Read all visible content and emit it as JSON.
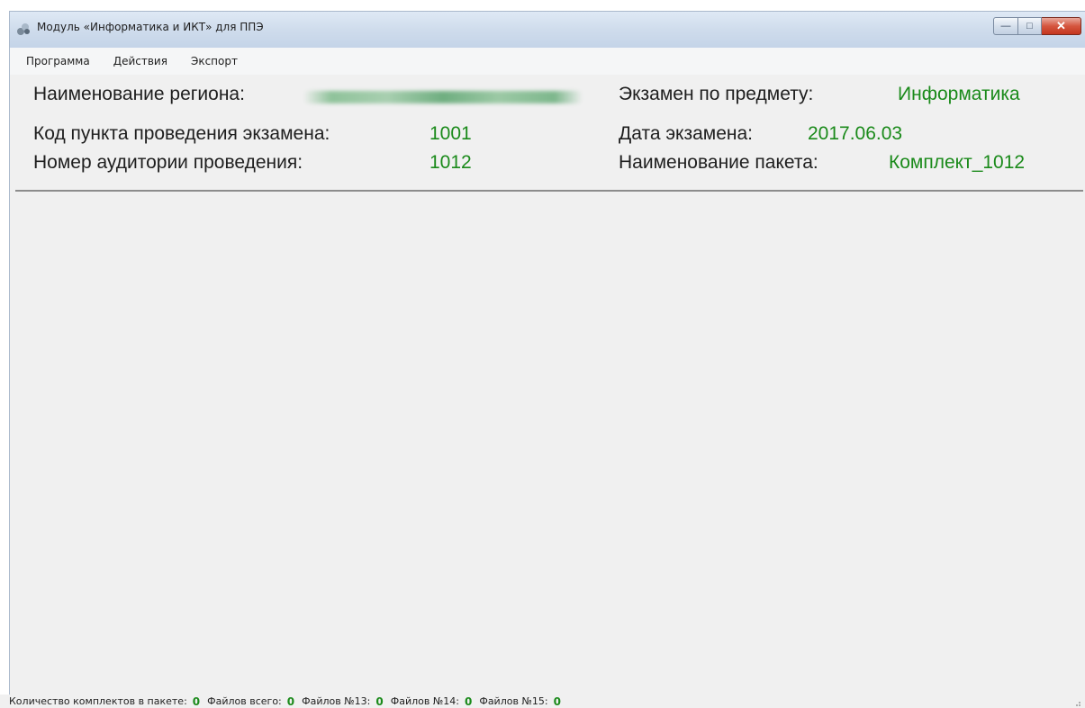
{
  "window": {
    "title": "Модуль «Информатика и ИКТ» для ППЭ",
    "controls": {
      "minimize": "—",
      "maximize": "□",
      "close": "✕"
    }
  },
  "menu": [
    "Программа",
    "Действия",
    "Экспорт"
  ],
  "header": {
    "region_label": "Наименование региона:",
    "region_value": "",
    "exam_label": "Экзамен по предмету:",
    "exam_value": "Информатика",
    "ppe_code_label": "Код пункта проведения экзамена:",
    "ppe_code_value": "1001",
    "exam_date_label": "Дата экзамена:",
    "exam_date_value": "2017.06.03",
    "auditorium_label": "Номер аудитории проведения:",
    "auditorium_value": "1012",
    "package_label": "Наименование пакета:",
    "package_value": "Комплект_1012"
  },
  "status": {
    "kits_label": "Количество комплектов в пакете:",
    "kits_value": "0",
    "files_total_label": "Файлов всего:",
    "files_total_value": "0",
    "files13_label": "Файлов №13:",
    "files13_value": "0",
    "files14_label": "Файлов №14:",
    "files14_value": "0",
    "files15_label": "Файлов №15:",
    "files15_value": "0"
  },
  "colors": {
    "value_green": "#1a8a1a",
    "panel_bg": "#f0f0f0",
    "close_red": "#c4361e"
  }
}
